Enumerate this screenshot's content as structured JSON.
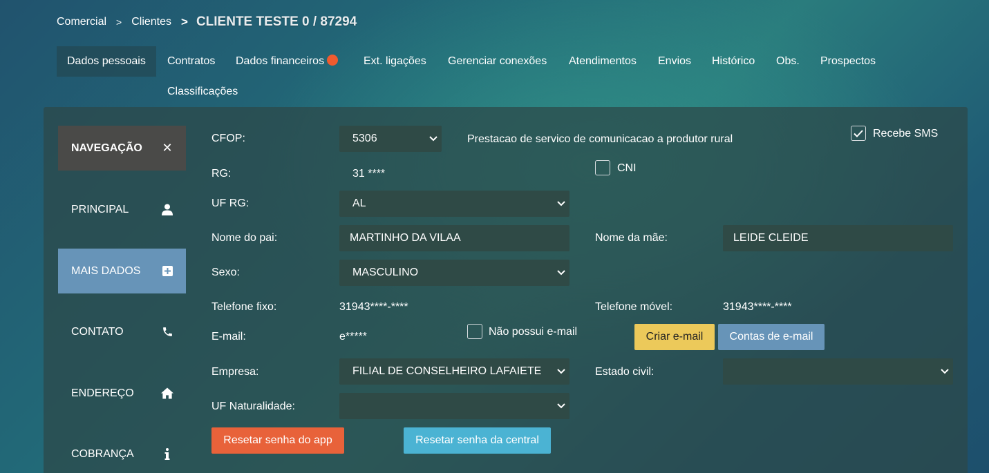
{
  "breadcrumb": {
    "items": [
      "Comercial",
      "Clientes"
    ],
    "separator": ">",
    "current": "CLIENTE TESTE 0 / 87294"
  },
  "tabs": [
    {
      "label": "Dados pessoais",
      "active": true
    },
    {
      "label": "Contratos"
    },
    {
      "label": "Dados financeiros",
      "badge": true
    },
    {
      "label": "Ext. ligações"
    },
    {
      "label": "Gerenciar conexões"
    },
    {
      "label": "Atendimentos"
    },
    {
      "label": "Envios"
    },
    {
      "label": "Histórico"
    },
    {
      "label": "Obs."
    },
    {
      "label": "Prospectos"
    },
    {
      "label": "Classificações"
    }
  ],
  "nav": {
    "header": "NAVEGAÇÃO",
    "items": [
      {
        "label": "PRINCIPAL",
        "icon": "user-icon"
      },
      {
        "label": "MAIS DADOS",
        "icon": "plus-square-icon",
        "active": true
      },
      {
        "label": "CONTATO",
        "icon": "phone-icon"
      },
      {
        "label": "ENDEREÇO",
        "icon": "home-icon"
      },
      {
        "label": "COBRANÇA",
        "icon": "info-icon"
      }
    ]
  },
  "form": {
    "cfop": {
      "label": "CFOP:",
      "value": "5306",
      "description": "Prestacao de servico de comunicacao a produtor rural"
    },
    "recebe_sms": {
      "label": "Recebe SMS",
      "checked": true
    },
    "rg": {
      "label": "RG:",
      "value": "31 ****"
    },
    "cni": {
      "label": "CNI",
      "checked": false
    },
    "uf_rg": {
      "label": "UF RG:",
      "value": "AL"
    },
    "nome_pai": {
      "label": "Nome do pai:",
      "value": "MARTINHO DA VILAA"
    },
    "nome_mae": {
      "label": "Nome da mãe:",
      "value": "LEIDE CLEIDE"
    },
    "sexo": {
      "label": "Sexo:",
      "value": "MASCULINO"
    },
    "telefone_fixo": {
      "label": "Telefone fixo:",
      "value": "31943****-****"
    },
    "telefone_movel": {
      "label": "Telefone móvel:",
      "value": "31943****-****"
    },
    "email": {
      "label": "E-mail:",
      "value": "e*****"
    },
    "nao_possui_email": {
      "label": "Não possui e-mail",
      "checked": false
    },
    "criar_email": "Criar e-mail",
    "contas_email": "Contas de e-mail",
    "empresa": {
      "label": "Empresa:",
      "value": "FILIAL DE CONSELHEIRO LAFAIETE"
    },
    "estado_civil": {
      "label": "Estado civil:",
      "value": ""
    },
    "uf_naturalidade": {
      "label": "UF Naturalidade:",
      "value": ""
    },
    "resetar_app": "Resetar senha do app",
    "resetar_central": "Resetar senha da central"
  },
  "colors": {
    "badge": "#ef5b2f",
    "nav_active": "#6794b8",
    "btn_yellow": "#ecc95a",
    "btn_blue": "#6794b8",
    "btn_orange": "#e8623a",
    "btn_cyan": "#4bb3d3"
  }
}
